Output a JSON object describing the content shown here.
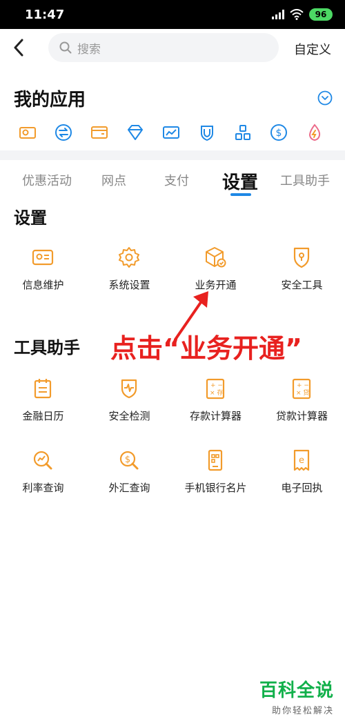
{
  "status_bar": {
    "time": "11:47",
    "battery": "96"
  },
  "header": {
    "search_placeholder": "搜索",
    "custom_label": "自定义"
  },
  "my_apps": {
    "title": "我的应用",
    "icons": [
      "card-icon",
      "transfer-icon",
      "wallet-icon",
      "diamond-icon",
      "chart-card-icon",
      "shield-icon",
      "blocks-icon",
      "dollar-icon",
      "flame-icon"
    ]
  },
  "tabs": [
    {
      "label": "优惠活动"
    },
    {
      "label": "网点"
    },
    {
      "label": "支付"
    },
    {
      "label": "设置",
      "active": true
    },
    {
      "label": "工具助手"
    }
  ],
  "settings_section": {
    "title": "设置",
    "items": [
      {
        "label": "信息维护",
        "icon": "id-card-icon"
      },
      {
        "label": "系统设置",
        "icon": "gear-icon"
      },
      {
        "label": "业务开通",
        "icon": "cube-check-icon"
      },
      {
        "label": "安全工具",
        "icon": "security-shield-icon"
      }
    ]
  },
  "tools_section": {
    "title": "工具助手",
    "items": [
      {
        "label": "金融日历",
        "icon": "calendar-icon"
      },
      {
        "label": "安全检测",
        "icon": "pulse-shield-icon"
      },
      {
        "label": "存款计算器",
        "icon": "calculator-deposit-icon"
      },
      {
        "label": "贷款计算器",
        "icon": "calculator-loan-icon"
      },
      {
        "label": "利率查询",
        "icon": "rate-search-icon"
      },
      {
        "label": "外汇查询",
        "icon": "currency-search-icon"
      },
      {
        "label": "手机银行名片",
        "icon": "phone-card-icon"
      },
      {
        "label": "电子回执",
        "icon": "receipt-icon"
      }
    ]
  },
  "annotation": {
    "text": "点击“业务开通”"
  },
  "watermark": {
    "title": "百科全说",
    "subtitle": "助你轻松解决"
  },
  "colors": {
    "accent_blue": "#1e88e5",
    "icon_orange": "#f29b2b",
    "annotation_red": "#e8211f",
    "watermark_green": "#11b04a"
  }
}
